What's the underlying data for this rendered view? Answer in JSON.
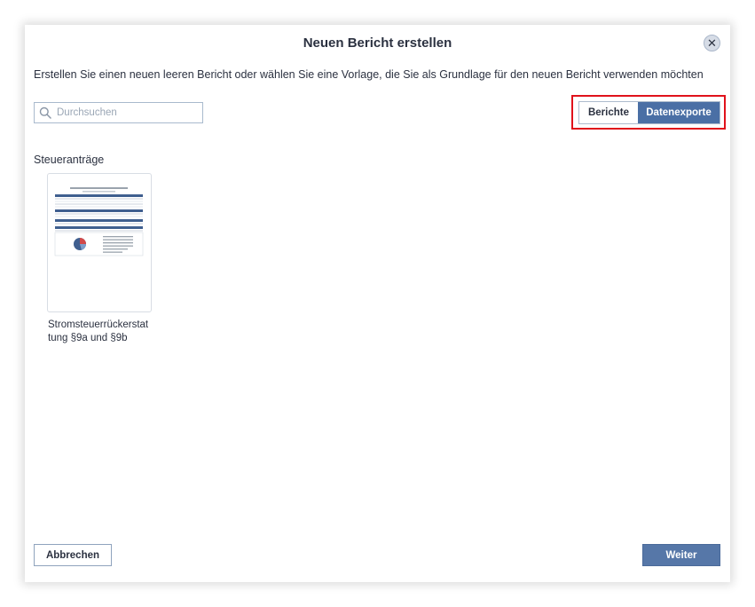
{
  "dialog": {
    "title": "Neuen Bericht erstellen",
    "close_icon": "close-icon",
    "subtitle": "Erstellen Sie einen neuen leeren Bericht oder wählen Sie eine Vorlage, die Sie als Grundlage für den neuen Bericht verwenden möchten"
  },
  "search": {
    "placeholder": "Durchsuchen",
    "value": "",
    "icon": "search-icon"
  },
  "toggle": {
    "options": [
      "Berichte",
      "Datenexporte"
    ],
    "selected": "Datenexporte"
  },
  "section": {
    "label": "Steueranträge",
    "templates": [
      {
        "label": "Stromsteuerrückerstattung §9a und §9b"
      }
    ]
  },
  "footer": {
    "cancel_label": "Abbrechen",
    "next_label": "Weiter"
  },
  "colors": {
    "accent": "#4a6fa5",
    "highlight": "#e0121b",
    "dialog_bg": "#ffffff",
    "text": "#2b3140"
  }
}
